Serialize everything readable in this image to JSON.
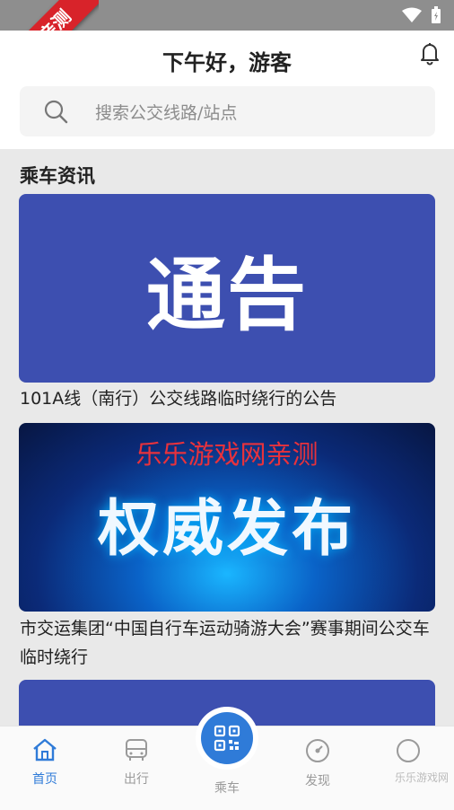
{
  "ribbon": "乐乐亲测",
  "header": {
    "greeting": "下午好，游客",
    "search_placeholder": "搜索公交线路/站点"
  },
  "section_title": "乘车资讯",
  "news": [
    {
      "image_text": "通告",
      "title": "101A线（南行）公交线路临时绕行的公告"
    },
    {
      "image_watermark": "乐乐游戏网亲测",
      "image_text": "权威发布",
      "title": "市交运集团“中国自行车运动骑游大会”赛事期间公交车临时绕行"
    }
  ],
  "tabs": {
    "home": "首页",
    "travel": "出行",
    "ride": "乘车",
    "discover": "发现"
  },
  "corner_watermark": "乐乐游戏网",
  "colors": {
    "accent": "#2f7bd8",
    "card_blue": "#3d4fb0",
    "ribbon_red": "#d8232a"
  }
}
